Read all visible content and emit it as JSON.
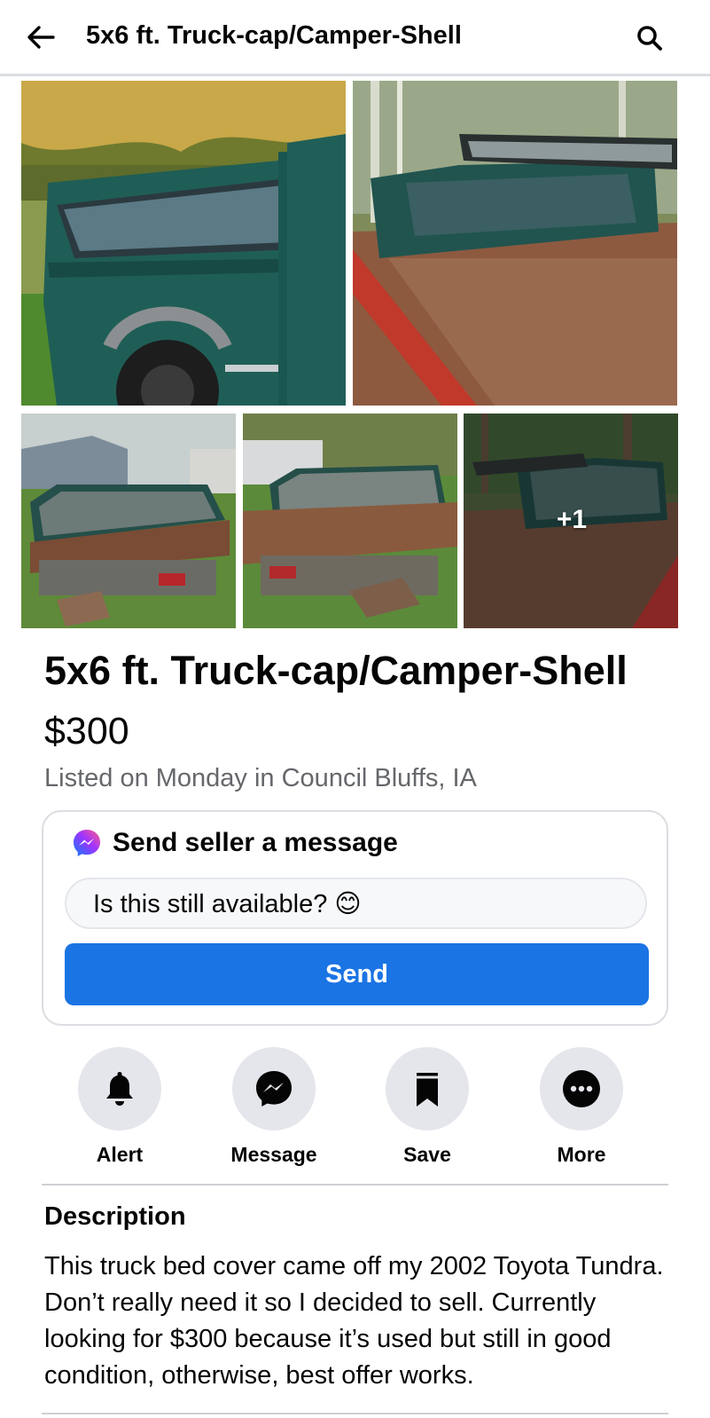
{
  "header": {
    "title": "5x6 ft. Truck-cap/Camper-Shell",
    "back_icon": "arrow-left-icon",
    "search_icon": "search-icon"
  },
  "gallery": {
    "more_count": "+1"
  },
  "listing": {
    "title": "5x6 ft. Truck-cap/Camper-Shell",
    "price": "$300",
    "meta": "Listed on Monday in Council Bluffs, IA"
  },
  "message_card": {
    "heading": "Send seller a message",
    "input_value": "Is this still available? 😊",
    "send_label": "Send"
  },
  "actions": [
    {
      "label": "Alert",
      "icon": "bell-icon"
    },
    {
      "label": "Message",
      "icon": "messenger-icon"
    },
    {
      "label": "Save",
      "icon": "bookmark-icon"
    },
    {
      "label": "More",
      "icon": "more-icon"
    }
  ],
  "description": {
    "heading": "Description",
    "body": "This truck bed cover came off my 2002 Toyota Tundra. Don’t really need it so I decided to sell. Currently looking for $300 because it’s used but still in good condition, otherwise, best offer works."
  },
  "colors": {
    "accent": "#1b74e4",
    "muted_text": "#65676b",
    "action_bg": "#e4e6eb"
  }
}
